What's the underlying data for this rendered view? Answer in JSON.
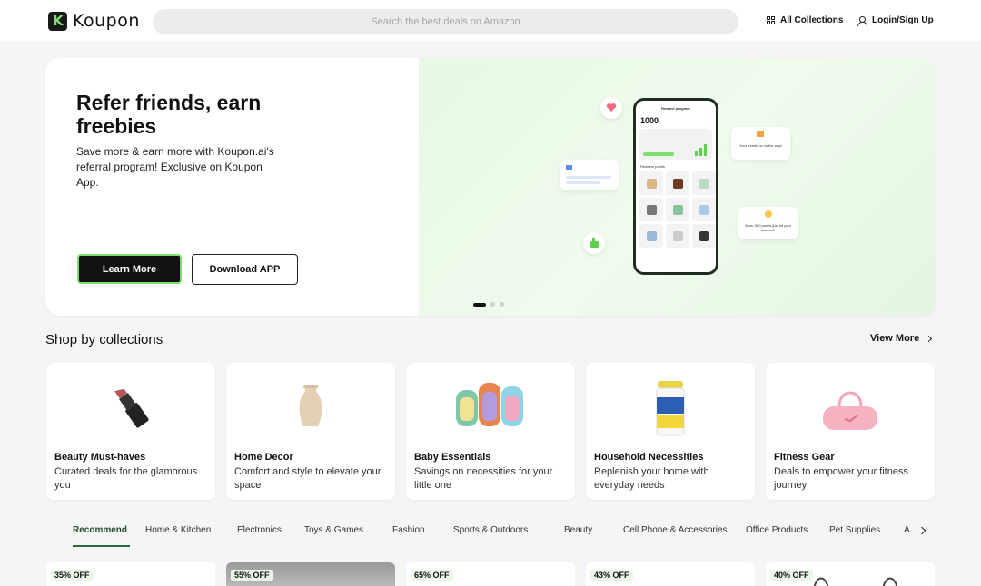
{
  "header": {
    "logo_text": "Koupon",
    "search_placeholder": "Search the best deals on Amazon",
    "collections_label": "All Collections",
    "login_label": "Login/Sign Up"
  },
  "hero": {
    "title": "Refer friends, earn freebies",
    "description": "Save more & earn more with Koupon.ai's referral program! Exclusive on Koupon App.",
    "learn_more_label": "Learn More",
    "download_label": "Download APP",
    "phone": {
      "header": "Reward program",
      "points": "1000",
      "redeem_label": "Redeem points"
    },
    "bubbles": {
      "freebie": "Your freebie is on the way!",
      "points_hit": "Wow, 600 points just hit your account!"
    },
    "carousel": {
      "count": 3,
      "active": 0
    }
  },
  "collections": {
    "title": "Shop by collections",
    "view_more_label": "View More",
    "items": [
      {
        "name": "Beauty Must-haves",
        "desc": "Curated deals for the glamorous you"
      },
      {
        "name": "Home Decor",
        "desc": "Comfort and style to elevate your space"
      },
      {
        "name": "Baby Essentials",
        "desc": "Savings on necessities for your little one"
      },
      {
        "name": "Household Necessities",
        "desc": "Replenish your home with everyday needs"
      },
      {
        "name": "Fitness Gear",
        "desc": "Deals to empower your fitness journey"
      }
    ]
  },
  "tabs": [
    "Recommend",
    "Home & Kitchen",
    "Electronics",
    "Toys & Games",
    "Fashion",
    "Sports & Outdoors",
    "Beauty",
    "Cell Phone & Accessories",
    "Office Products",
    "Pet Supplies",
    "A"
  ],
  "deals": [
    {
      "badge": "35% OFF"
    },
    {
      "badge": "55% OFF"
    },
    {
      "badge": "65% OFF"
    },
    {
      "badge": "43% OFF"
    },
    {
      "badge": "40% OFF"
    }
  ],
  "colors": {
    "accent": "#7be06b",
    "dark": "#111111",
    "tab_active": "#2d6a3a"
  }
}
